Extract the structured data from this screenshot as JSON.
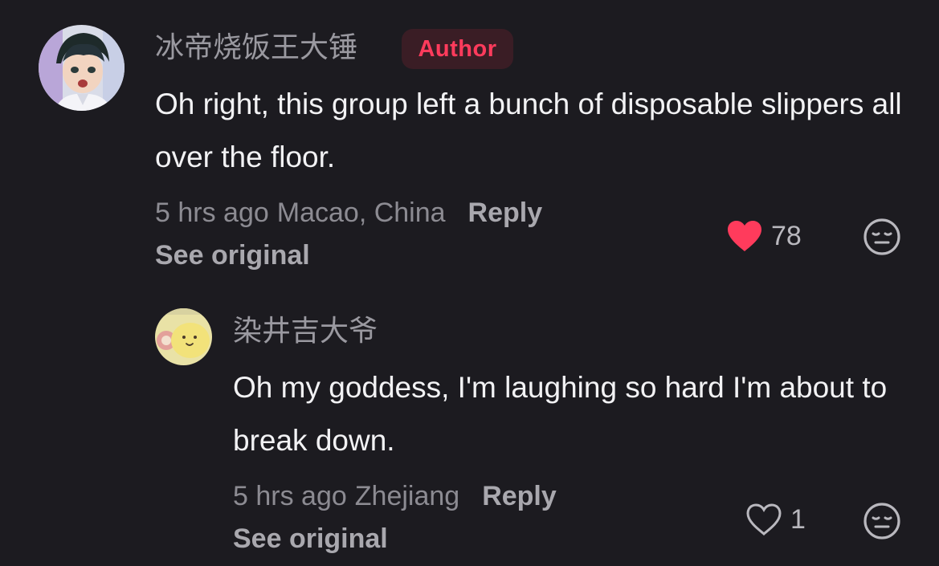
{
  "colors": {
    "background": "#1c1b20",
    "username": "#9a99a0",
    "author_badge_text": "#ff3b5c",
    "author_badge_bg": "#3a1d25",
    "like_active": "#ff3b5c",
    "meta": "#8c8b92"
  },
  "comment": {
    "username": "冰帝烧饭王大锤",
    "badge": "Author",
    "text": "Oh right, this group left a bunch of disposable slippers all over the floor.",
    "time": "5 hrs ago",
    "location": "Macao, China",
    "reply_label": "Reply",
    "see_original_label": "See original",
    "like_count": "78",
    "liked": true,
    "avatar_icon": "anime-avatar-icon"
  },
  "reply": {
    "username": "染井吉大爷",
    "text": "Oh my goddess, I'm laughing so hard I'm about to break down.",
    "time": "5 hrs ago",
    "location": "Zhejiang",
    "reply_label": "Reply",
    "see_original_label": "See original",
    "like_count": "1",
    "liked": false,
    "avatar_icon": "yellow-character-avatar-icon"
  }
}
